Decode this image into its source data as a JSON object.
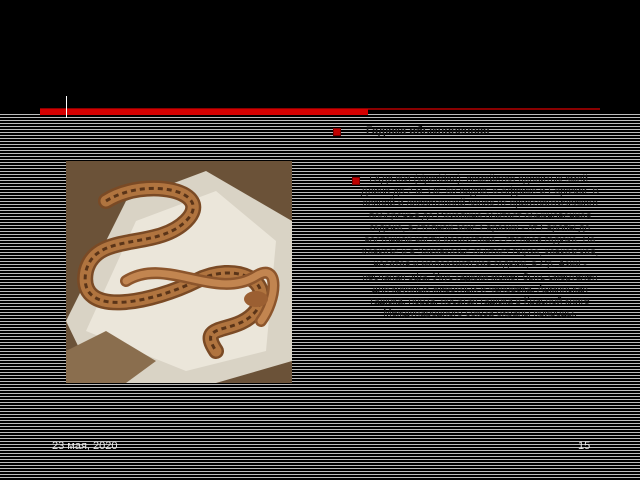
{
  "slide": {
    "heading": "Гадюка обыкновенная",
    "body": "ГАДЮКИ (viperidae), семейство ядовитых змей. Длина до 2 м. Ок. 60 видов, в Африке и Евразии. В лесной и лесостепной зонах от приатлантического побережья до Сахалина обитает обыкновенная гадюка, в степной зоне Евразии - от Европы до восточной части Казахстана - степная гадюка. На Кавказе и в Закавказье обитает гюрза, кавказская, носатая и малоазиатская гадюки, в Ср. Азии - песчаная эфа. Укус гадюки может быть смертелен для крупных животных и человека. Армянская гадюка, гюрза, носатая гадюка в Красной книге Международного союза охраны природы.",
    "footer_date": "23 мая, 2020",
    "page_number": "15"
  },
  "colors": {
    "accent": "#d40000",
    "bullet": "#c00000",
    "background": "#000000"
  }
}
